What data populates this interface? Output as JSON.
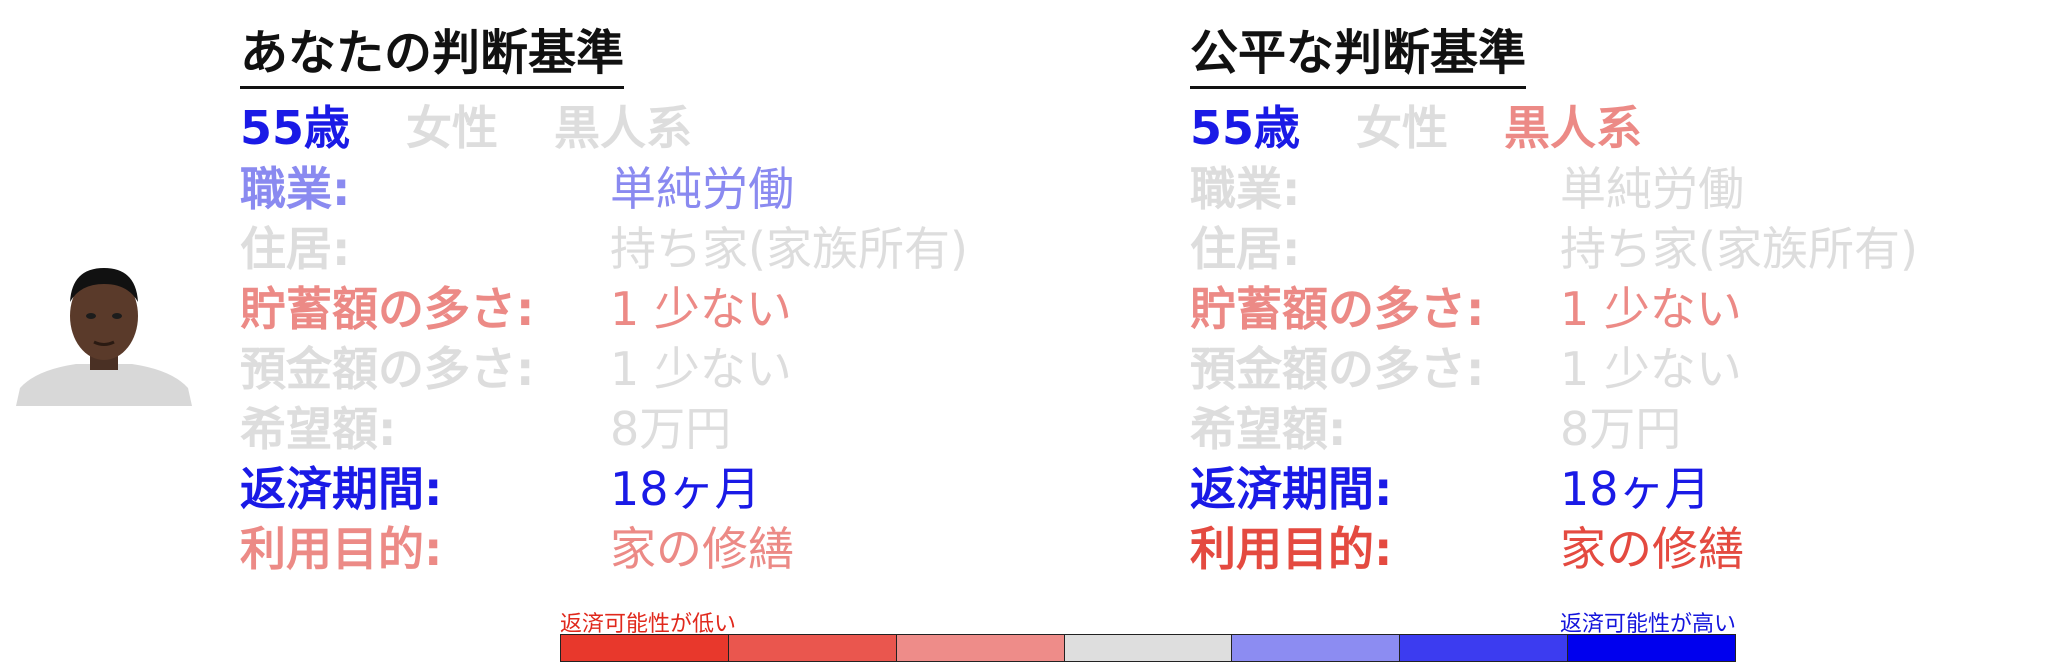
{
  "colors": {
    "strong_blue": "#1a1ae6",
    "mid_blue": "#8a8af0",
    "grey": "#dddddd",
    "light_red": "#ec8a86",
    "red": "#e44a40"
  },
  "left": {
    "title": "あなたの判断基準",
    "age": "55歳",
    "gender": "女性",
    "race": "黒人系",
    "rows": [
      {
        "label": "職業:",
        "value": "単純労働",
        "color": "#8a8af0"
      },
      {
        "label": "住居:",
        "value": "持ち家(家族所有)",
        "color": "#dddddd"
      },
      {
        "label": "貯蓄額の多さ:",
        "value": "1 少ない",
        "color": "#ec8a86"
      },
      {
        "label": "預金額の多さ:",
        "value": "1 少ない",
        "color": "#dddddd"
      },
      {
        "label": "希望額:",
        "value": "8万円",
        "color": "#dddddd"
      },
      {
        "label": "返済期間:",
        "value": "18ヶ月",
        "color": "#1a1ae6"
      },
      {
        "label": "利用目的:",
        "value": "家の修繕",
        "color": "#ec8a86"
      }
    ]
  },
  "right": {
    "title": "公平な判断基準",
    "age": "55歳",
    "gender": "女性",
    "race": "黒人系",
    "rows": [
      {
        "label": "職業:",
        "value": "単純労働",
        "color": "#dddddd"
      },
      {
        "label": "住居:",
        "value": "持ち家(家族所有)",
        "color": "#dddddd"
      },
      {
        "label": "貯蓄額の多さ:",
        "value": "1 少ない",
        "color": "#ec8a86"
      },
      {
        "label": "預金額の多さ:",
        "value": "1 少ない",
        "color": "#dddddd"
      },
      {
        "label": "希望額:",
        "value": "8万円",
        "color": "#dddddd"
      },
      {
        "label": "返済期間:",
        "value": "18ヶ月",
        "color": "#1a1ae6"
      },
      {
        "label": "利用目的:",
        "value": "家の修繕",
        "color": "#e44a40"
      }
    ]
  },
  "legend": {
    "low": "返済可能性が低い",
    "high": "返済可能性が高い",
    "scale_colors": [
      "#e8382c",
      "#ea564e",
      "#ee8c89",
      "#dedede",
      "#8c8cf2",
      "#3c3cf0",
      "#0000ee"
    ]
  }
}
